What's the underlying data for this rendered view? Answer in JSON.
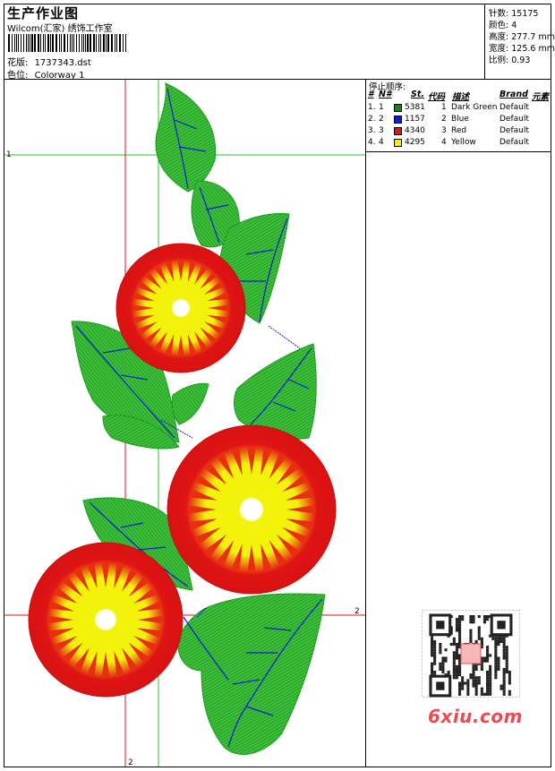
{
  "header": {
    "title": "生产作业图",
    "subtitle": "Wilcom(汇家) 绣饰工作室",
    "design_label": "花版:",
    "design_value": "1737343.dst",
    "colorway_label": "色位:",
    "colorway_value": "Colorway 1"
  },
  "stats": {
    "stitches_label": "针数:",
    "stitches": "15175",
    "colors_label": "颜色:",
    "colors": "4",
    "height_label": "高度:",
    "height": "277.7 mm",
    "width_label": "宽度:",
    "width": "125.6 mm",
    "scale_label": "比例:",
    "scale": "0.93"
  },
  "stop_sequence": {
    "title": "停止顺序:",
    "headers": {
      "num": "#",
      "no": "N#",
      "st": "St.",
      "code": "代码",
      "desc": "描述",
      "brand": "Brand",
      "element": "元素"
    },
    "rows": [
      {
        "num": "1.",
        "no": "1",
        "color": "#0f8a1a",
        "st": "5381",
        "code": "1",
        "desc": "Dark Green",
        "brand": "Default"
      },
      {
        "num": "2.",
        "no": "2",
        "color": "#0a1fd8",
        "st": "1157",
        "code": "2",
        "desc": "Blue",
        "brand": "Default"
      },
      {
        "num": "3.",
        "no": "3",
        "color": "#e01414",
        "st": "4340",
        "code": "3",
        "desc": "Red",
        "brand": "Default"
      },
      {
        "num": "4.",
        "no": "4",
        "color": "#f2f20a",
        "st": "4295",
        "code": "4",
        "desc": "Yellow",
        "brand": "Default"
      }
    ]
  },
  "guides": {
    "green_h_label": "1",
    "red_h_label": "2",
    "red_v_label": "2"
  },
  "watermark": {
    "logo_text": "6xiu.com"
  },
  "colors": {
    "green": "#27a32a",
    "dark_green": "#0f8a1a",
    "blue": "#0a1fd8",
    "red": "#e01414",
    "yellow": "#f2f20a"
  }
}
